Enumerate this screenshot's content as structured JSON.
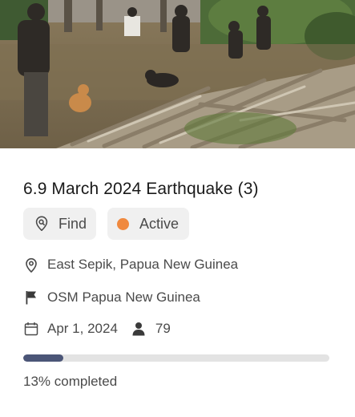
{
  "project": {
    "title": "6.9 March 2024 Earthquake (3)",
    "location": "East Sepik, Papua New Guinea",
    "organisation": "OSM Papua New Guinea",
    "date": "Apr 1, 2024",
    "contributors": "79",
    "progress_percent": 13,
    "progress_label": "13% completed"
  },
  "chips": {
    "find_label": "Find",
    "status_label": "Active"
  },
  "colors": {
    "status_dot": "#f0893f",
    "progress_fill": "#4b5577",
    "progress_track": "#e3e3e3"
  },
  "icons": {
    "find": "map-pin-search-icon",
    "location": "map-pin-icon",
    "organisation": "flag-icon",
    "date": "calendar-icon",
    "contributors": "person-icon"
  }
}
